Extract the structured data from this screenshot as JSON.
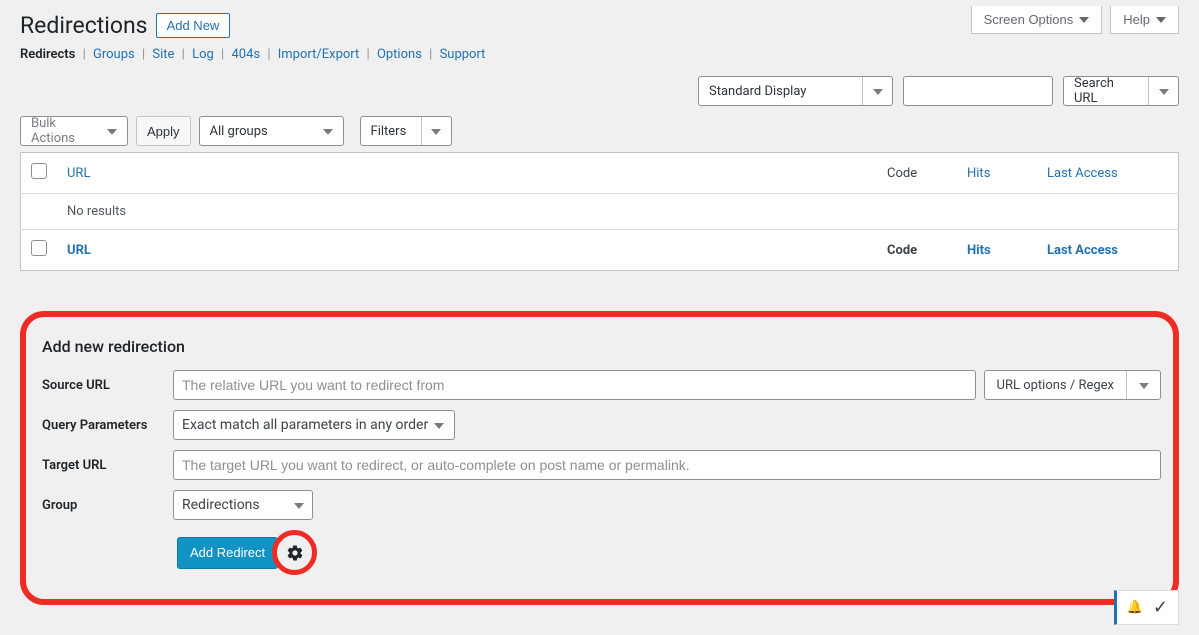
{
  "top": {
    "screen_options": "Screen Options",
    "help": "Help"
  },
  "title": "Redirections",
  "add_new": "Add New",
  "subnav": {
    "redirects": "Redirects",
    "groups": "Groups",
    "site": "Site",
    "log": "Log",
    "fourofour": "404s",
    "import_export": "Import/Export",
    "options": "Options",
    "support": "Support"
  },
  "filters": {
    "display": "Standard Display",
    "search_button": "Search URL"
  },
  "actions": {
    "bulk": "Bulk Actions",
    "apply": "Apply",
    "group": "All groups",
    "filters": "Filters"
  },
  "table": {
    "url": "URL",
    "code": "Code",
    "hits": "Hits",
    "last_access": "Last Access",
    "no_results": "No results"
  },
  "form": {
    "heading": "Add new redirection",
    "source_label": "Source URL",
    "source_placeholder": "The relative URL you want to redirect from",
    "url_options": "URL options / Regex",
    "query_label": "Query Parameters",
    "query_value": "Exact match all parameters in any order",
    "target_label": "Target URL",
    "target_placeholder": "The target URL you want to redirect, or auto-complete on post name or permalink.",
    "group_label": "Group",
    "group_value": "Redirections",
    "submit": "Add Redirect"
  }
}
